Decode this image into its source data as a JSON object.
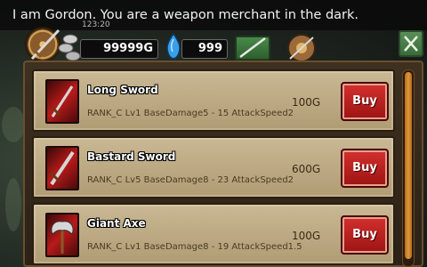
{
  "dialogue": {
    "text": "I am Gordon. You are a weapon merchant in the dark."
  },
  "hud": {
    "timer": "123:20",
    "gold": "99999G",
    "gems": "999"
  },
  "icons": {
    "shield": "shield-icon",
    "coins": "coins-icon",
    "gem": "gem-icon",
    "weapon_tab": "sword-icon",
    "armor_tab": "shield-icon",
    "close": "close-icon"
  },
  "items": [
    {
      "name": "Long Sword",
      "stats": "RANK_C Lv1 BaseDamage5 - 15 AttackSpeed2",
      "price": "100G",
      "buy_label": "Buy",
      "icon": "sword-icon"
    },
    {
      "name": "Bastard Sword",
      "stats": "RANK_C Lv5 BaseDamage8 - 23 AttackSpeed2",
      "price": "600G",
      "buy_label": "Buy",
      "icon": "sword-icon"
    },
    {
      "name": "Giant Axe",
      "stats": "RANK_C Lv1 BaseDamage8 - 19 AttackSpeed1.5",
      "price": "100G",
      "buy_label": "Buy",
      "icon": "axe-icon"
    }
  ],
  "colors": {
    "buy_button": "#c22420",
    "scrollbar": "#e0973a",
    "row_background": "#c0ad86"
  }
}
